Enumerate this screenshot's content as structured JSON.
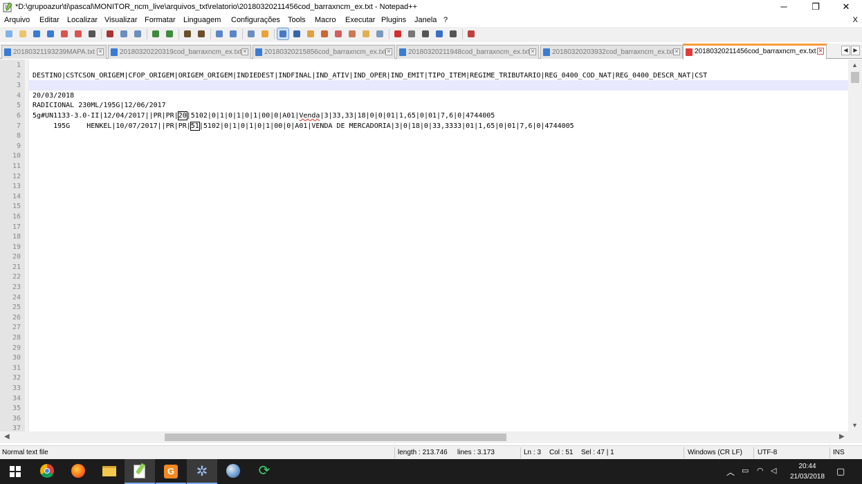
{
  "window": {
    "title": "*D:\\grupoazur\\ti\\pascal\\MONITOR_ncm_live\\arquivos_txt\\relatorio\\20180320211456cod_barraxncm_ex.txt - Notepad++",
    "minimize": "─",
    "maximize": "❐",
    "close": "✕"
  },
  "menu": {
    "items": [
      "Arquivo",
      "Editar",
      "Localizar",
      "Visualizar",
      "Formatar",
      "Linguagem",
      "Configurações",
      "Tools",
      "Macro",
      "Executar",
      "Plugins",
      "Janela",
      "?"
    ],
    "close": "X"
  },
  "toolbar": {
    "icons": [
      "new-file-icon",
      "open-file-icon",
      "save-icon",
      "save-all-icon",
      "close-icon",
      "close-all-icon",
      "print-icon",
      "cut-icon",
      "copy-icon",
      "paste-icon",
      "undo-icon",
      "redo-icon",
      "find-icon",
      "find-replace-icon",
      "zoom-in-icon",
      "zoom-out-icon",
      "sync-vertical-icon",
      "sync-horizontal-icon",
      "word-wrap-icon",
      "show-all-chars-icon",
      "indent-guide-icon",
      "user-lang-icon",
      "doc-map-icon",
      "function-list-icon",
      "folder-workspace-icon",
      "monitoring-icon",
      "record-macro-icon",
      "stop-record-icon",
      "play-macro-icon",
      "run-macro-multiple-icon",
      "save-macro-icon",
      "spell-check-icon"
    ]
  },
  "tabs": [
    {
      "label": "20180321193239MAPA.txt",
      "active": false
    },
    {
      "label": "20180320220319cod_barraxncm_ex.txt",
      "active": false
    },
    {
      "label": "20180320215856cod_barraxncm_ex.txt",
      "active": false
    },
    {
      "label": "20180320211948cod_barraxncm_ex.txt",
      "active": false
    },
    {
      "label": "20180320203932cod_barraxncm_ex.txt",
      "active": false
    },
    {
      "label": "20180320211456cod_barraxncm_ex.txt",
      "active": true
    }
  ],
  "editor": {
    "line_numbers": [
      "1",
      "2",
      "3",
      "4",
      "5",
      "6",
      "7",
      "8",
      "9",
      "10",
      "11",
      "12",
      "13",
      "14",
      "15",
      "16",
      "17",
      "18",
      "19",
      "20",
      "21",
      "22",
      "23",
      "24",
      "25",
      "26",
      "27",
      "28",
      "29",
      "30",
      "31",
      "32",
      "33",
      "34",
      "35",
      "36",
      "37"
    ],
    "current_line": 3,
    "lines": {
      "l2": "DESTINO|CSTCSON_ORIGEM|CFOP_ORIGEM|ORIGEM_ORIGEM|INDIEDEST|INDFINAL|IND_ATIV|IND_OPER|IND_EMIT|TIPO_ITEM|REGIME_TRIBUTARIO|REG_0400_COD_NAT|REG_0400_DESCR_NAT|CST",
      "l4": "20/03/2018",
      "l5": "RADICIONAL 230ML/195G|12/06/2017",
      "l6_a": "5g#UN1133-3.0-II|12/04/2017||PR|PR|",
      "l6_box": "20",
      "l6_b": "|5102|0|1|0|1|0|1|00|0|A01|",
      "l6_err": "Venda",
      "l6_c": "|3|33,33|18|0|0|01|1,65|0|01|7,6|0|4744005",
      "l7_a": "     195G    HENKEL|10/07/2017||PR|PR|",
      "l7_box": "51",
      "l7_b": "|5102|0|1|0|1|0|1|00|0|A01|VENDA DE MERCADORIA|3|0|18|0|33,3333|01|1,65|0|01|7,6|0|4744005"
    }
  },
  "statusbar": {
    "file_type": "Normal text file",
    "length": "length : 213.746",
    "lines": "lines : 3.173",
    "ln": "Ln : 3",
    "col": "Col : 51",
    "sel": "Sel : 47 | 1",
    "eol": "Windows (CR LF)",
    "encoding": "UTF-8",
    "mode": "INS"
  },
  "taskbar": {
    "apps": [
      "start-icon",
      "chrome-icon",
      "firefox-icon",
      "file-explorer-icon",
      "notepadpp-icon",
      "gmail-icon",
      "gear-app-icon",
      "paint-icon",
      "sync-app-icon"
    ],
    "time": "20:44",
    "date": "21/03/2018"
  },
  "colors": {
    "active_tab_accent": "#f79a3a",
    "current_line_bg": "#e8e8ff",
    "taskbar_bg": "#1c1c1c"
  }
}
